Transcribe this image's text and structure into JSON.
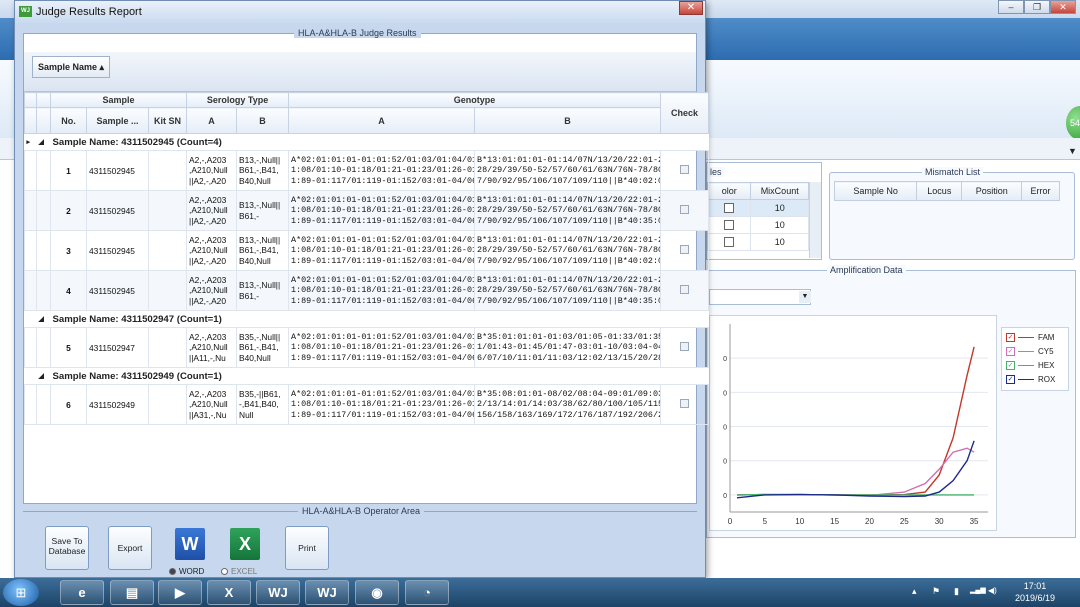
{
  "dialog": {
    "title": "Judge Results Report",
    "close_glyph": "✕",
    "icon_text": "WJ"
  },
  "results": {
    "group_title": "HLA-A&HLA-B Judge Results",
    "sort_button": "Sample Name ▴",
    "header_top": {
      "sample": "Sample",
      "serology": "Serology Type",
      "genotype": "Genotype"
    },
    "columns": {
      "no": "No.",
      "sample_name": "Sample ...",
      "sort_glyph": "▴",
      "kit_sn": "Kit SN",
      "sero_a": "A",
      "sero_b": "B",
      "geno_a": "A",
      "geno_b": "B",
      "check": "Check"
    },
    "groups": [
      {
        "label": "Sample Name: 4311502945 (Count=4)",
        "rows": [
          {
            "no": "1",
            "sample": "4311502945",
            "kit": "",
            "sero_a": "A2,-,A203\n,A210,Null\n||A2,-,A20",
            "sero_b": "B13,-,Null||\nB61,-,B41,\nB40,Null",
            "geno_a": "A*02:01:01:01-01:01:52/01:03/01:04/01:06-0\n1:08/01:10-01:18/01:21-01:23/01:26-01:87/0\n1:89-01:117/01:119-01:152/03:01-04/06:01:0",
            "geno_b": "B*13:01:01:01-01:14/07N/13/20/22:01-26:02/\n28/29/39/50-52/57/60/61/63N/76N-78/80/83/8\n7/90/92/95/106/107/109/110||B*40:02:01:01-"
          },
          {
            "no": "2",
            "sample": "4311502945",
            "kit": "",
            "sero_a": "A2,-,A203\n,A210,Null\n||A2,-,A20",
            "sero_b": "B13,-,Null||\nB61,-",
            "geno_a": "A*02:01:01:01-01:01:52/01:03/01:04/01:06-0\n1:08/01:10-01:18/01:21-01:23/01:26-01:87/0\n1:89-01:117/01:119-01:152/03:01-04/06:01:0",
            "geno_b": "B*13:01:01:01-01:14/07N/13/20/22:01-26:02/\n28/29/39/50-52/57/60/61/63N/76N-78/80/83/8\n7/90/92/95/106/107/109/110||B*40:35:01/35:"
          },
          {
            "no": "3",
            "sample": "4311502945",
            "kit": "",
            "sero_a": "A2,-,A203\n,A210,Null\n||A2,-,A20",
            "sero_b": "B13,-,Null||\nB61,-,B41,\nB40,Null",
            "geno_a": "A*02:01:01:01-01:01:52/01:03/01:04/01:06-0\n1:08/01:10-01:18/01:21-01:23/01:26-01:87/0\n1:89-01:117/01:119-01:152/03:01-04/06:01:0",
            "geno_b": "B*13:01:01:01-01:14/07N/13/20/22:01-26:02/\n28/29/39/50-52/57/60/61/63N/76N-78/80/83/8\n7/90/92/95/106/107/109/110||B*40:02:01:01-"
          },
          {
            "no": "4",
            "sample": "4311502945",
            "kit": "",
            "sero_a": "A2,-,A203\n,A210,Null\n||A2,-,A20",
            "sero_b": "B13,-,Null||\nB61,-",
            "geno_a": "A*02:01:01:01-01:01:52/01:03/01:04/01:06-0\n1:08/01:10-01:18/01:21-01:23/01:26-01:87/0\n1:89-01:117/01:119-01:152/03:01-04/06:01:0",
            "geno_b": "B*13:01:01:01-01:14/07N/13/20/22:01-26:02/\n28/29/39/50-52/57/60/61/63N/76N-78/80/83/8\n7/90/92/95/106/107/109/110||B*40:35:01/35:"
          }
        ]
      },
      {
        "label": "Sample Name: 4311502947 (Count=1)",
        "rows": [
          {
            "no": "5",
            "sample": "4311502947",
            "kit": "",
            "sero_a": "A2,-,A203\n,A210,Null\n||A11,-,Nu",
            "sero_b": "B35,-,Null||\nB61,-,B41,\nB40,Null",
            "geno_a": "A*02:01:01:01-01:01:52/01:03/01:04/01:06-0\n1:08/01:10-01:18/01:21-01:23/01:26-01:87/0\n1:89-01:117/01:119-01:152/03:01-04/06:01:0",
            "geno_b": "B*35:01:01:01-01:03/01:05-01:33/01:35-01:4\n1/01:43-01:45/01:47-03:01-10/03:04-04:03/0\n6/07/10/11:01/11:03/12:02/13/15/20/28/29/3"
          }
        ]
      },
      {
        "label": "Sample Name: 4311502949 (Count=1)",
        "rows": [
          {
            "no": "6",
            "sample": "4311502949",
            "kit": "",
            "sero_a": "A2,-,A203\n,A210,Null\n||A31,-,Nu",
            "sero_b": "B35,-||B61,\n-,B41,B40,\nNull",
            "geno_a": "A*02:01:01:01-01:01:52/01:03/01:04/01:06-0\n1:08/01:10-01:18/01:21-01:23/01:26-01:87/0\n1:89-01:117/01:119-01:152/03:01-04/06:01:0",
            "geno_b": "B*35:08:01:01-08/02/08:04-09:01/09:03/12:0\n2/13/14:01/14:03/38/62/80/100/105/115/142/\n156/158/163/169/172/176/187/192/206/213/2"
          }
        ]
      }
    ]
  },
  "operator": {
    "group_title": "HLA-A&HLA-B Operator Area",
    "save_label": "Save To\nDatabase",
    "export_label": "Export",
    "print_label": "Print",
    "word_label": "WORD",
    "excel_label": "EXCEL",
    "word_icon_text": "W",
    "excel_icon_text": "X"
  },
  "bg_app": {
    "left_panel_title": "les",
    "left_panel_cols": [
      "olor",
      "MixCount"
    ],
    "left_panel_values": [
      "10",
      "10",
      "10"
    ],
    "mismatch_title": "Mismatch List",
    "mismatch_cols": [
      "Sample No",
      "Locus",
      "Position",
      "Error"
    ],
    "amp_title": "Amplification Data",
    "side_badge": "54",
    "dropdown_glyph": "▼",
    "titlebar_buttons": [
      "–",
      "❐",
      "✕"
    ]
  },
  "chart_data": {
    "type": "line",
    "x_ticks": [
      "0",
      "5",
      "10",
      "15",
      "20",
      "25",
      "30",
      "35"
    ],
    "y_ticks": [
      "0",
      "0",
      "0",
      "0",
      "0"
    ],
    "xlim": [
      0,
      37
    ],
    "series": [
      {
        "name": "FAM",
        "color": "#c0392b",
        "points": [
          [
            1,
            0
          ],
          [
            5,
            0.005
          ],
          [
            10,
            0.005
          ],
          [
            15,
            0
          ],
          [
            20,
            0
          ],
          [
            25,
            0.005
          ],
          [
            28,
            0.05
          ],
          [
            30,
            0.35
          ],
          [
            32,
            1.0
          ],
          [
            34,
            2.1
          ],
          [
            35,
            2.6
          ]
        ]
      },
      {
        "name": "CY5",
        "color": "#d06fb4",
        "points": [
          [
            1,
            0
          ],
          [
            5,
            0.005
          ],
          [
            10,
            0.005
          ],
          [
            15,
            0
          ],
          [
            20,
            -0.01
          ],
          [
            25,
            0.05
          ],
          [
            28,
            0.2
          ],
          [
            30,
            0.45
          ],
          [
            32,
            0.75
          ],
          [
            34,
            0.82
          ],
          [
            35,
            0.75
          ]
        ]
      },
      {
        "name": "HEX",
        "color": "#45b36b",
        "points": [
          [
            1,
            0
          ],
          [
            5,
            0.005
          ],
          [
            10,
            0.005
          ],
          [
            15,
            0
          ],
          [
            20,
            0
          ],
          [
            25,
            0
          ],
          [
            30,
            0
          ],
          [
            35,
            0
          ]
        ]
      },
      {
        "name": "ROX",
        "color": "#1c2a8c",
        "points": [
          [
            1,
            -0.05
          ],
          [
            5,
            0
          ],
          [
            10,
            0.005
          ],
          [
            15,
            0
          ],
          [
            20,
            -0.02
          ],
          [
            25,
            -0.03
          ],
          [
            28,
            -0.02
          ],
          [
            30,
            0.05
          ],
          [
            32,
            0.25
          ],
          [
            34,
            0.6
          ],
          [
            35,
            0.95
          ]
        ]
      }
    ]
  },
  "taskbar": {
    "start_glyph": "⊞",
    "apps": [
      "e",
      "▤",
      "▶",
      "X",
      "WJ",
      "WJ",
      "◉",
      "◔"
    ],
    "time": "17:01",
    "date": "2019/6/19",
    "tray": [
      "▴",
      "⚑",
      "▮",
      "▂▄▆",
      "◀)"
    ]
  }
}
